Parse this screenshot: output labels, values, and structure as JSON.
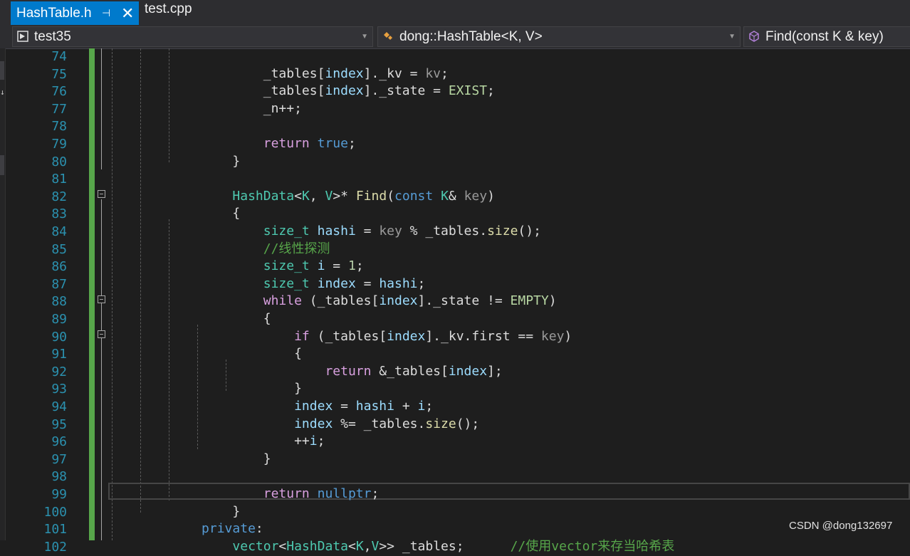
{
  "tabs": {
    "active": {
      "label": "HashTable.h",
      "pin_icon": "pin-icon",
      "close_icon": "close-icon"
    },
    "inactive": [
      {
        "label": "test.cpp"
      }
    ]
  },
  "navigation": {
    "project": "test35",
    "scope": "dong::HashTable<K, V>",
    "member": "Find(const K & key)"
  },
  "editor": {
    "line_numbers": [
      "74",
      "75",
      "76",
      "77",
      "78",
      "79",
      "80",
      "81",
      "82",
      "83",
      "84",
      "85",
      "86",
      "87",
      "88",
      "89",
      "90",
      "91",
      "92",
      "93",
      "94",
      "95",
      "96",
      "97",
      "98",
      "99",
      "100",
      "101",
      "102"
    ],
    "lines": [
      [],
      [
        {
          "t": "                    _tables[",
          "c": ""
        },
        {
          "t": "index",
          "c": "var"
        },
        {
          "t": "]._kv = ",
          "c": ""
        },
        {
          "t": "kv",
          "c": "par"
        },
        {
          "t": ";",
          "c": ""
        }
      ],
      [
        {
          "t": "                    _tables[",
          "c": ""
        },
        {
          "t": "index",
          "c": "var"
        },
        {
          "t": "]._state = ",
          "c": ""
        },
        {
          "t": "EXIST",
          "c": "en"
        },
        {
          "t": ";",
          "c": ""
        }
      ],
      [
        {
          "t": "                    _n++;",
          "c": ""
        }
      ],
      [],
      [
        {
          "t": "                    ",
          "c": ""
        },
        {
          "t": "return",
          "c": "ctl"
        },
        {
          "t": " ",
          "c": ""
        },
        {
          "t": "true",
          "c": "kw"
        },
        {
          "t": ";",
          "c": ""
        }
      ],
      [
        {
          "t": "                }",
          "c": ""
        }
      ],
      [],
      [
        {
          "t": "                ",
          "c": ""
        },
        {
          "t": "HashData",
          "c": "ty"
        },
        {
          "t": "<",
          "c": ""
        },
        {
          "t": "K",
          "c": "ty"
        },
        {
          "t": ", ",
          "c": ""
        },
        {
          "t": "V",
          "c": "ty"
        },
        {
          "t": ">* ",
          "c": ""
        },
        {
          "t": "Find",
          "c": "fn"
        },
        {
          "t": "(",
          "c": ""
        },
        {
          "t": "const",
          "c": "kw"
        },
        {
          "t": " ",
          "c": ""
        },
        {
          "t": "K",
          "c": "ty"
        },
        {
          "t": "& ",
          "c": ""
        },
        {
          "t": "key",
          "c": "par"
        },
        {
          "t": ")",
          "c": ""
        }
      ],
      [
        {
          "t": "                {",
          "c": ""
        }
      ],
      [
        {
          "t": "                    ",
          "c": ""
        },
        {
          "t": "size_t",
          "c": "ty"
        },
        {
          "t": " ",
          "c": ""
        },
        {
          "t": "hashi",
          "c": "var"
        },
        {
          "t": " = ",
          "c": ""
        },
        {
          "t": "key",
          "c": "par"
        },
        {
          "t": " % _tables.",
          "c": ""
        },
        {
          "t": "size",
          "c": "fn"
        },
        {
          "t": "();",
          "c": ""
        }
      ],
      [
        {
          "t": "                    ",
          "c": ""
        },
        {
          "t": "//线性探测",
          "c": "cm"
        }
      ],
      [
        {
          "t": "                    ",
          "c": ""
        },
        {
          "t": "size_t",
          "c": "ty"
        },
        {
          "t": " ",
          "c": ""
        },
        {
          "t": "i",
          "c": "var"
        },
        {
          "t": " = ",
          "c": ""
        },
        {
          "t": "1",
          "c": "num"
        },
        {
          "t": ";",
          "c": ""
        }
      ],
      [
        {
          "t": "                    ",
          "c": ""
        },
        {
          "t": "size_t",
          "c": "ty"
        },
        {
          "t": " ",
          "c": ""
        },
        {
          "t": "index",
          "c": "var"
        },
        {
          "t": " = ",
          "c": ""
        },
        {
          "t": "hashi",
          "c": "var"
        },
        {
          "t": ";",
          "c": ""
        }
      ],
      [
        {
          "t": "                    ",
          "c": ""
        },
        {
          "t": "while",
          "c": "ctl"
        },
        {
          "t": " (_tables[",
          "c": ""
        },
        {
          "t": "index",
          "c": "var"
        },
        {
          "t": "]._state != ",
          "c": ""
        },
        {
          "t": "EMPTY",
          "c": "en"
        },
        {
          "t": ")",
          "c": ""
        }
      ],
      [
        {
          "t": "                    {",
          "c": ""
        }
      ],
      [
        {
          "t": "                        ",
          "c": ""
        },
        {
          "t": "if",
          "c": "ctl"
        },
        {
          "t": " (_tables[",
          "c": ""
        },
        {
          "t": "index",
          "c": "var"
        },
        {
          "t": "]._kv.first == ",
          "c": ""
        },
        {
          "t": "key",
          "c": "par"
        },
        {
          "t": ")",
          "c": ""
        }
      ],
      [
        {
          "t": "                        {",
          "c": ""
        }
      ],
      [
        {
          "t": "                            ",
          "c": ""
        },
        {
          "t": "return",
          "c": "ctl"
        },
        {
          "t": " &_tables[",
          "c": ""
        },
        {
          "t": "index",
          "c": "var"
        },
        {
          "t": "];",
          "c": ""
        }
      ],
      [
        {
          "t": "                        }",
          "c": ""
        }
      ],
      [
        {
          "t": "                        ",
          "c": ""
        },
        {
          "t": "index",
          "c": "var"
        },
        {
          "t": " = ",
          "c": ""
        },
        {
          "t": "hashi",
          "c": "var"
        },
        {
          "t": " + ",
          "c": ""
        },
        {
          "t": "i",
          "c": "var"
        },
        {
          "t": ";",
          "c": ""
        }
      ],
      [
        {
          "t": "                        ",
          "c": ""
        },
        {
          "t": "index",
          "c": "var"
        },
        {
          "t": " %= _tables.",
          "c": ""
        },
        {
          "t": "size",
          "c": "fn"
        },
        {
          "t": "();",
          "c": ""
        }
      ],
      [
        {
          "t": "                        ++",
          "c": ""
        },
        {
          "t": "i",
          "c": "var"
        },
        {
          "t": ";",
          "c": ""
        }
      ],
      [
        {
          "t": "                    }",
          "c": ""
        }
      ],
      [],
      [
        {
          "t": "                    ",
          "c": ""
        },
        {
          "t": "return",
          "c": "ctl"
        },
        {
          "t": " ",
          "c": ""
        },
        {
          "t": "nullptr",
          "c": "kw"
        },
        {
          "t": ";",
          "c": ""
        }
      ],
      [
        {
          "t": "                }",
          "c": ""
        }
      ],
      [
        {
          "t": "            ",
          "c": ""
        },
        {
          "t": "private",
          "c": "kw"
        },
        {
          "t": ":",
          "c": ""
        }
      ],
      [
        {
          "t": "                ",
          "c": ""
        },
        {
          "t": "vector",
          "c": "ty"
        },
        {
          "t": "<",
          "c": ""
        },
        {
          "t": "HashData",
          "c": "ty"
        },
        {
          "t": "<",
          "c": ""
        },
        {
          "t": "K",
          "c": "ty"
        },
        {
          "t": ",",
          "c": ""
        },
        {
          "t": "V",
          "c": "ty"
        },
        {
          "t": ">> _tables;      ",
          "c": ""
        },
        {
          "t": "//使用vector来存当哈希表",
          "c": "cm"
        }
      ]
    ]
  },
  "watermark": "CSDN @dong132697"
}
